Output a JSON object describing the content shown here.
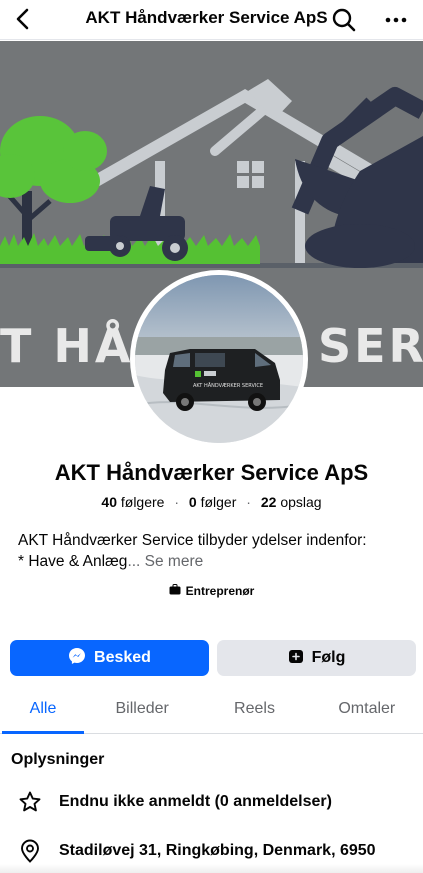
{
  "header": {
    "title": "AKT Håndværker Service ApS",
    "back_icon": "chevron-left-icon",
    "search_icon": "search-icon",
    "more_icon": "more-horizontal-icon"
  },
  "cover": {
    "text_left": "T HÅNDV",
    "text_right": "SERV"
  },
  "profile": {
    "name": "AKT Håndværker Service ApS",
    "van_text": "AKT HÅNDVÆRKER SERVICE",
    "followers_count": "40",
    "followers_label": "følgere",
    "following_count": "0",
    "following_label": "følger",
    "posts_count": "22",
    "posts_label": "opslag",
    "bio_line1": "AKT Håndværker Service tilbyder ydelser indenfor:",
    "bio_line2": "* Have & Anlæg",
    "bio_more": "... Se mere",
    "category": "Entreprenør"
  },
  "actions": {
    "message_label": "Besked",
    "follow_label": "Følg"
  },
  "tabs": [
    {
      "label": "Alle",
      "active": true
    },
    {
      "label": "Billeder",
      "active": false
    },
    {
      "label": "Reels",
      "active": false
    },
    {
      "label": "Omtaler",
      "active": false
    }
  ],
  "info": {
    "title": "Oplysninger",
    "rating": "Endnu ikke anmeldt (0 anmeldelser)",
    "address": "Stadiløvej 31, Ringkøbing, Denmark, 6950"
  },
  "colors": {
    "accent": "#0866ff",
    "cover_bg": "#737678",
    "button_secondary": "#e4e6eb"
  }
}
